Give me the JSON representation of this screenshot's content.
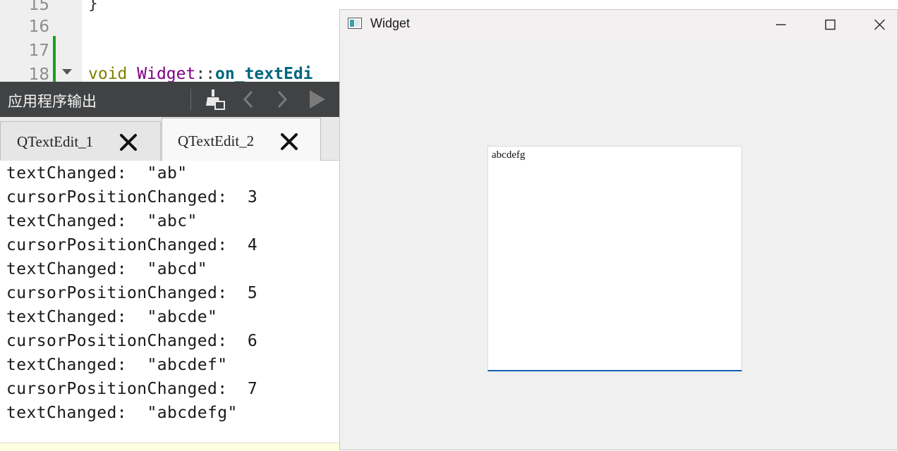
{
  "editor": {
    "line_numbers": [
      "15",
      "16",
      "17",
      "18"
    ],
    "lines": [
      "}",
      "",
      "",
      ""
    ],
    "code_line_18": {
      "keyword": "void",
      "class_name": "Widget",
      "scope": "::",
      "function": "on_textEdi"
    }
  },
  "output_pane": {
    "title": "应用程序输出",
    "toolbar_icons": [
      "clean-output-icon",
      "previous-icon",
      "next-icon",
      "run-icon"
    ],
    "tabs": [
      {
        "label": "QTextEdit_1",
        "active": false
      },
      {
        "label": "QTextEdit_2",
        "active": true
      }
    ],
    "lines": [
      "textChanged:  \"ab\"",
      "cursorPositionChanged:  3",
      "textChanged:  \"abc\"",
      "cursorPositionChanged:  4",
      "textChanged:  \"abcd\"",
      "cursorPositionChanged:  5",
      "textChanged:  \"abcde\"",
      "cursorPositionChanged:  6",
      "textChanged:  \"abcdef\"",
      "cursorPositionChanged:  7",
      "textChanged:  \"abcdefg\""
    ]
  },
  "widget_window": {
    "title": "Widget",
    "buttons": [
      "minimize-icon",
      "maximize-icon",
      "close-icon"
    ],
    "text_edit": {
      "value": "abcdefg"
    }
  },
  "colors": {
    "gutter_change": "#1ba11b",
    "toolbar_bg": "#404244",
    "focus_underline": "#0f5fb5"
  }
}
